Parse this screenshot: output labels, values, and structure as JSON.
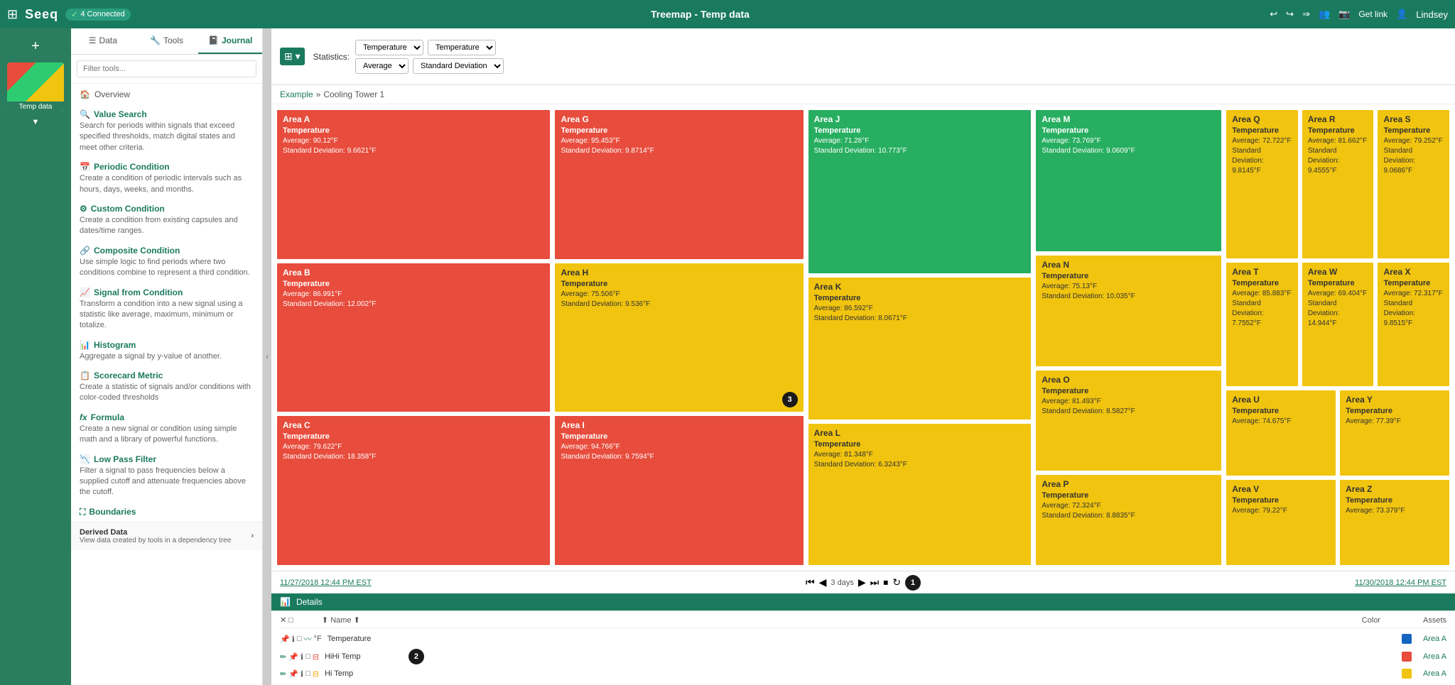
{
  "app": {
    "logo": "Seeq",
    "connected": "4 Connected",
    "title": "Treemap - Temp data",
    "nav_back": "←",
    "nav_forward": "→",
    "get_link": "Get link",
    "user": "Lindsey"
  },
  "sidebar": {
    "tabs": [
      {
        "id": "data",
        "label": "Data",
        "icon": "☰"
      },
      {
        "id": "tools",
        "label": "Tools",
        "icon": "🔧"
      },
      {
        "id": "journal",
        "label": "Journal",
        "icon": "📓"
      }
    ],
    "search_placeholder": "Filter tools...",
    "overview_label": "Overview",
    "tools": [
      {
        "id": "value-search",
        "title": "Value Search",
        "icon": "🔍",
        "desc": "Search for periods within signals that exceed specified thresholds, match digital states and meet other criteria."
      },
      {
        "id": "periodic-condition",
        "title": "Periodic Condition",
        "icon": "📅",
        "desc": "Create a condition of periodic intervals such as hours, days, weeks, and months."
      },
      {
        "id": "custom-condition",
        "title": "Custom Condition",
        "icon": "⚙",
        "desc": "Create a condition from existing capsules and dates/time ranges."
      },
      {
        "id": "composite-condition",
        "title": "Composite Condition",
        "icon": "🔗",
        "desc": "Use simple logic to find periods where two conditions combine to represent a third condition."
      },
      {
        "id": "signal-from-condition",
        "title": "Signal from Condition",
        "icon": "📈",
        "desc": "Transform a condition into a new signal using a statistic like average, maximum, minimum or totalize."
      },
      {
        "id": "histogram",
        "title": "Histogram",
        "icon": "📊",
        "desc": "Aggregate a signal by y-value of another."
      },
      {
        "id": "scorecard-metric",
        "title": "Scorecard Metric",
        "icon": "📋",
        "desc": "Create a statistic of signals and/or conditions with color-coded thresholds"
      },
      {
        "id": "formula",
        "title": "Formula",
        "icon": "fx",
        "desc": "Create a new signal or condition using simple math and a library of powerful functions."
      },
      {
        "id": "low-pass-filter",
        "title": "Low Pass Filter",
        "icon": "📉",
        "desc": "Filter a signal to pass frequencies below a supplied cutoff and attenuate frequencies above the cutoff."
      },
      {
        "id": "boundaries",
        "title": "Boundaries",
        "icon": "⛶",
        "desc": ""
      }
    ],
    "derived_data": {
      "label": "Derived Data",
      "desc": "View data created by tools in a dependency tree"
    }
  },
  "toolbar": {
    "stats_label": "Statistics:",
    "dropdown1_options": [
      "Temperature"
    ],
    "dropdown2_options": [
      "Temperature"
    ],
    "dropdown3_options": [
      "Average"
    ],
    "dropdown4_options": [
      "Standard Deviation"
    ],
    "dropdown1_selected": "Temperature",
    "dropdown2_selected": "Temperature",
    "dropdown3_selected": "Average",
    "dropdown4_selected": "Standard Deviation"
  },
  "breadcrumb": {
    "example": "Example",
    "separator": "»",
    "current": "Cooling Tower 1"
  },
  "treemap": {
    "cells": [
      {
        "id": "area-a",
        "label": "Area A",
        "color": "red",
        "metric": "Temperature",
        "avg": "90.12°F",
        "std": "9.6621°F"
      },
      {
        "id": "area-b",
        "label": "Area B",
        "color": "red",
        "metric": "Temperature",
        "avg": "86.991°F",
        "std": "12.002°F"
      },
      {
        "id": "area-c",
        "label": "Area C",
        "color": "red",
        "metric": "Temperature",
        "avg": "79.622°F",
        "std": "18.358°F"
      },
      {
        "id": "area-g",
        "label": "Area G",
        "color": "red",
        "metric": "Temperature",
        "avg": "95.453°F",
        "std": "9.8714°F"
      },
      {
        "id": "area-h",
        "label": "Area H",
        "color": "yellow",
        "metric": "Temperature",
        "avg": "75.506°F",
        "std": "9.536°F"
      },
      {
        "id": "area-i",
        "label": "Area I",
        "color": "red",
        "metric": "Temperature",
        "avg": "94.766°F",
        "std": "9.7594°F"
      },
      {
        "id": "area-j",
        "label": "Area J",
        "color": "green",
        "metric": "Temperature",
        "avg": "71.28°F",
        "std": "10.773°F"
      },
      {
        "id": "area-k",
        "label": "Area K",
        "color": "yellow",
        "metric": "Temperature",
        "avg": "86.592°F",
        "std": "8.0671°F"
      },
      {
        "id": "area-l",
        "label": "Area L",
        "color": "yellow",
        "metric": "Temperature",
        "avg": "81.348°F",
        "std": "6.3243°F"
      },
      {
        "id": "area-m",
        "label": "Area M",
        "color": "green",
        "metric": "Temperature",
        "avg": "73.769°F",
        "std": "9.0609°F"
      },
      {
        "id": "area-n",
        "label": "Area N",
        "color": "yellow",
        "metric": "Temperature",
        "avg": "75.13°F",
        "std": "10.035°F"
      },
      {
        "id": "area-o",
        "label": "Area O",
        "color": "yellow",
        "metric": "Temperature",
        "avg": "81.493°F",
        "std": "8.5827°F"
      },
      {
        "id": "area-p",
        "label": "Area P",
        "color": "yellow",
        "metric": "Temperature",
        "avg": "72.324°F",
        "std": "8.8835°F"
      },
      {
        "id": "area-q",
        "label": "Area Q",
        "color": "yellow",
        "metric": "Temperature",
        "avg": "72.722°F",
        "std": "9.8145°F"
      },
      {
        "id": "area-r",
        "label": "Area R",
        "color": "yellow",
        "metric": "Temperature",
        "avg": "81.662°F",
        "std": "9.4555°F"
      },
      {
        "id": "area-s",
        "label": "Area S",
        "color": "yellow",
        "metric": "Temperature",
        "avg": "79.252°F",
        "std": "9.0686°F"
      },
      {
        "id": "area-t",
        "label": "Area T",
        "color": "yellow",
        "metric": "Temperature",
        "avg": "85.883°F",
        "std": "7.7552°F"
      },
      {
        "id": "area-u",
        "label": "Area U",
        "color": "yellow",
        "metric": "Temperature",
        "avg": "74.675°F",
        "std": ""
      },
      {
        "id": "area-v",
        "label": "Area V",
        "color": "yellow",
        "metric": "Temperature",
        "avg": "79.22°F",
        "std": ""
      },
      {
        "id": "area-w",
        "label": "Area W",
        "color": "yellow",
        "metric": "Temperature",
        "avg": "69.404°F",
        "std": "14.944°F"
      },
      {
        "id": "area-x",
        "label": "Area X",
        "color": "yellow",
        "metric": "Temperature",
        "avg": "72.317°F",
        "std": "9.8515°F"
      },
      {
        "id": "area-y",
        "label": "Area Y",
        "color": "yellow",
        "metric": "Temperature",
        "avg": "77.39°F",
        "std": ""
      },
      {
        "id": "area-z",
        "label": "Area Z",
        "color": "yellow",
        "metric": "Temperature",
        "avg": "73.379°F",
        "std": ""
      }
    ]
  },
  "time_nav": {
    "start": "11/27/2018 12:44 PM EST",
    "end": "11/30/2018 12:44 PM EST",
    "duration": "3 days",
    "badge1": "1"
  },
  "details_panel": {
    "header": "Details",
    "columns": [
      "Name",
      "Color",
      "Assets"
    ],
    "rows": [
      {
        "name": "Temperature",
        "color_hex": "#1565c0",
        "asset": "Area A"
      },
      {
        "name": "HiHi Temp",
        "color_hex": "#e74c3c",
        "asset": "Area A"
      },
      {
        "name": "Hi Temp",
        "color_hex": "#f1c40f",
        "asset": "Area A"
      }
    ],
    "badge2": "2",
    "badge3": "3"
  }
}
